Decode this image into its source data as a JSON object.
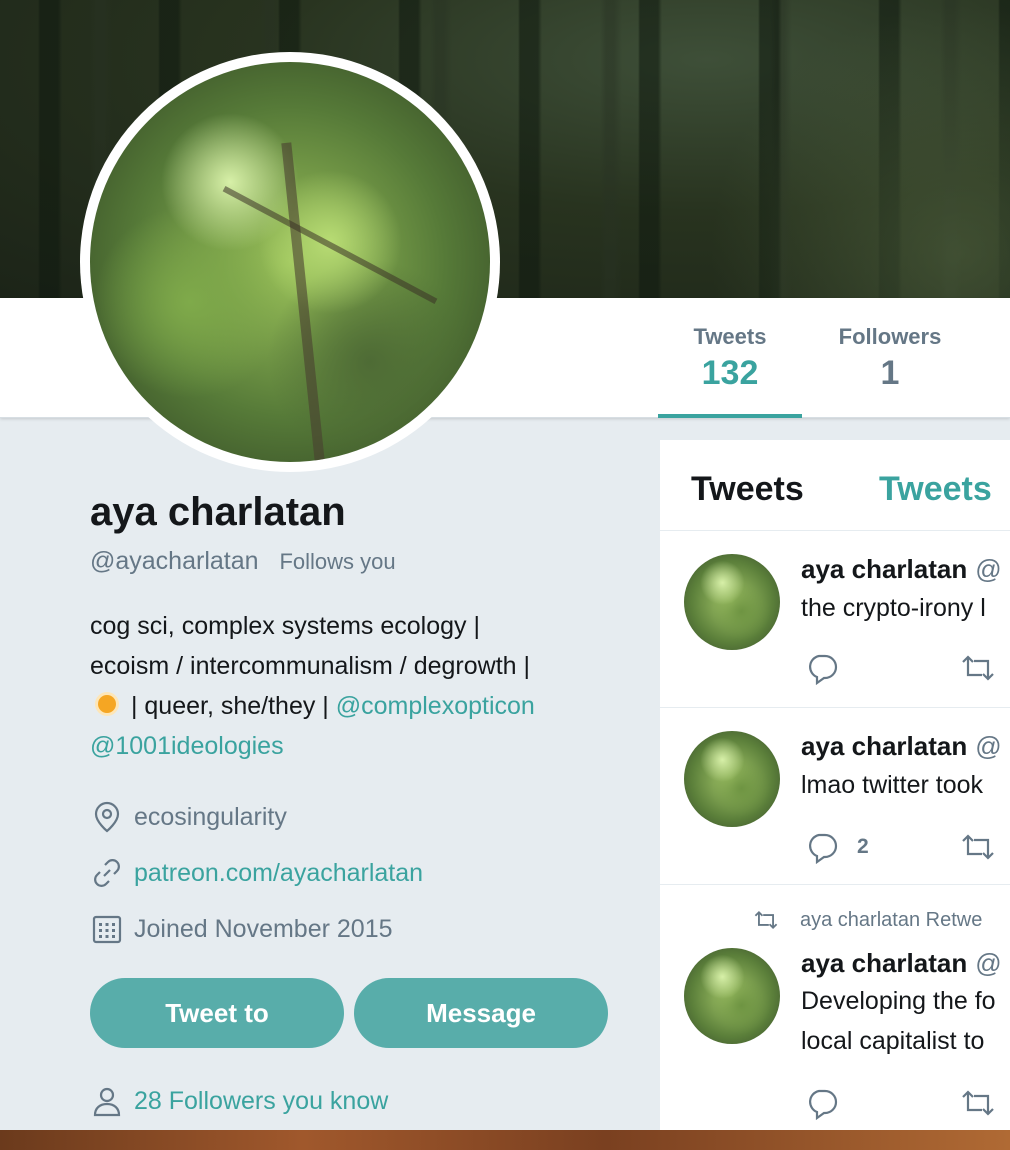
{
  "nav": {
    "tweets_label": "Tweets",
    "tweets_count": "132",
    "followers_label": "Followers",
    "followers_count": "1"
  },
  "profile": {
    "name": "aya charlatan",
    "handle": "@ayacharlatan",
    "follows_badge": "Follows you",
    "bio_line1": "cog sci, complex systems ecology |",
    "bio_line2": "ecoism / intercommunalism / degrowth |",
    "bio_line3_text": " | queer, she/they | ",
    "bio_link1": "@complexopticon",
    "bio_link2": "@1001ideologies",
    "location": "ecosingularity",
    "website": "patreon.com/ayacharlatan",
    "joined": "Joined November 2015",
    "followers_you_know": "28 Followers you know"
  },
  "buttons": {
    "tweet_to": "Tweet to",
    "message": "Message"
  },
  "timeline": {
    "tab1": "Tweets",
    "tab2": "Tweets",
    "tweets": [
      {
        "author": "aya charlatan",
        "at": "@",
        "text1": "the crypto-irony l",
        "reply_count": ""
      },
      {
        "author": "aya charlatan",
        "at": "@",
        "text1": "lmao twitter took",
        "reply_count": "2"
      },
      {
        "retweet_context": "aya charlatan Retwe",
        "author": "aya charlatan",
        "at": "@",
        "text1": "Developing the fo",
        "text2": "local capitalist to",
        "reply_count": ""
      }
    ]
  },
  "colors": {
    "accent": "#3aa39f",
    "button": "#58adaa",
    "secondary_text": "#657786",
    "background": "#e6ecf0"
  }
}
